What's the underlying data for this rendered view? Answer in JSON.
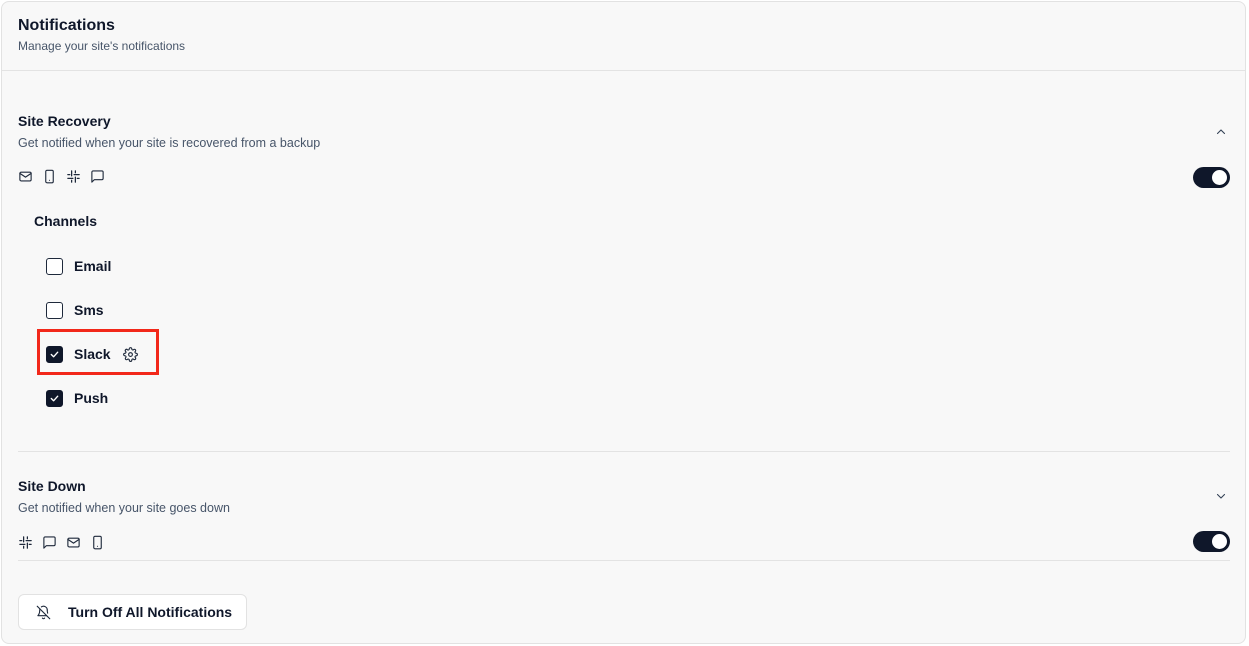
{
  "header": {
    "title": "Notifications",
    "subtitle": "Manage your site's notifications"
  },
  "sections": [
    {
      "title": "Site Recovery",
      "description": "Get notified when your site is recovered from a backup",
      "expanded": true,
      "enabled": true,
      "channel_icons": [
        "mail-icon",
        "smartphone-icon",
        "slack-icon",
        "message-square-icon"
      ],
      "channels_label": "Channels",
      "channels": [
        {
          "label": "Email",
          "checked": false
        },
        {
          "label": "Sms",
          "checked": false
        },
        {
          "label": "Slack",
          "checked": true,
          "has_settings": true
        },
        {
          "label": "Push",
          "checked": true
        }
      ]
    },
    {
      "title": "Site Down",
      "description": "Get notified when your site goes down",
      "expanded": false,
      "enabled": true,
      "channel_icons": [
        "slack-icon",
        "message-square-icon",
        "mail-icon",
        "smartphone-icon"
      ]
    }
  ],
  "footer": {
    "turn_off_label": "Turn Off All Notifications"
  },
  "colors": {
    "accent": "#0f172a",
    "highlight": "#f2281a",
    "muted_text": "#475569",
    "background": "#f8f8f8"
  }
}
